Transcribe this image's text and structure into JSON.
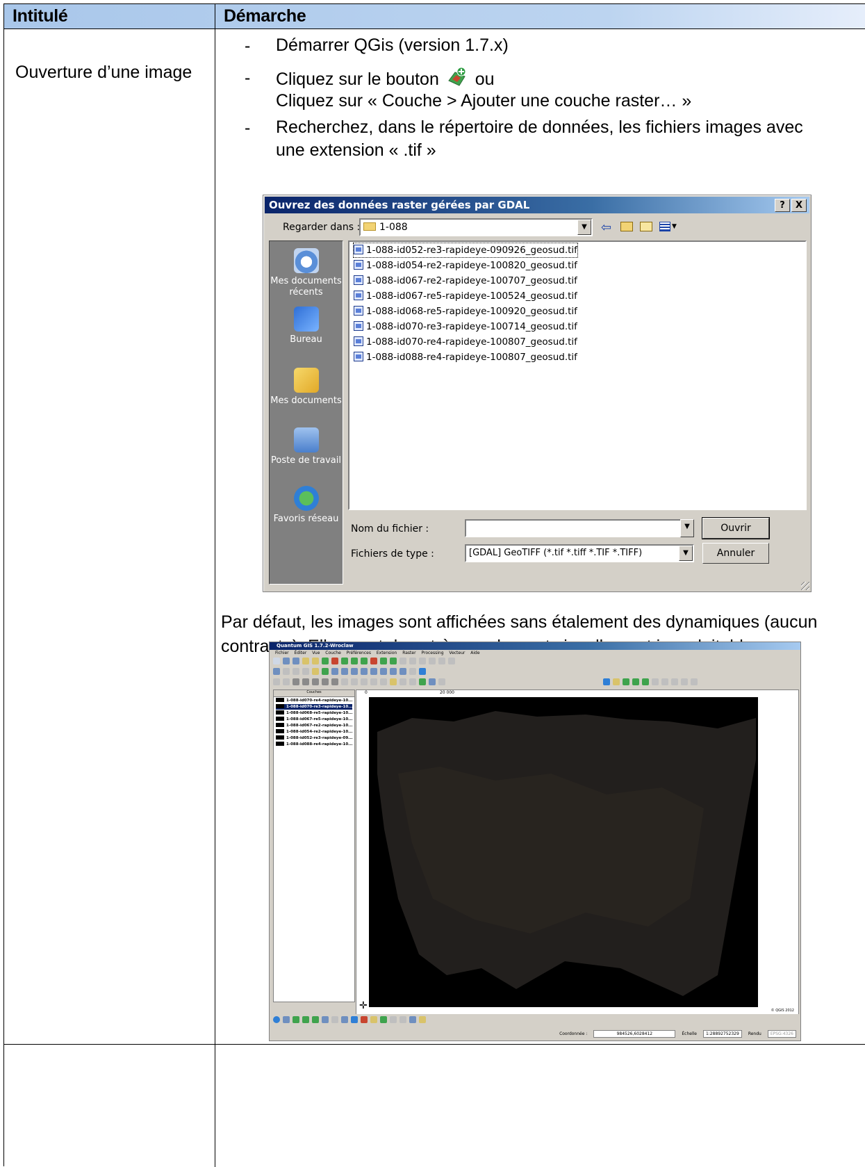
{
  "table": {
    "header_col1": "Intitulé",
    "header_col2": "Démarche",
    "row1_label": "Ouverture d’une image"
  },
  "steps": {
    "s1": "Démarrer QGis (version 1.7.x)",
    "s2a": "Cliquez sur le bouton",
    "s2b": "ou",
    "s2c": "Cliquez sur « Couche > Ajouter une couche raster… »",
    "s3a": "Recherchez, dans le répertoire de données, les fichiers images avec",
    "s3b": "une extension « .tif »",
    "dash": "-"
  },
  "dialog": {
    "title": "Ouvrez des données raster gérées par GDAL",
    "help_btn": "?",
    "close_btn": "X",
    "look_in_label": "Regarder dans :",
    "look_in_value": "1-088",
    "places": [
      "Mes documents récents",
      "Bureau",
      "Mes documents",
      "Poste de travail",
      "Favoris réseau"
    ],
    "files": [
      "1-088-id052-re3-rapideye-090926_geosud.tif",
      "1-088-id054-re2-rapideye-100820_geosud.tif",
      "1-088-id067-re2-rapideye-100707_geosud.tif",
      "1-088-id067-re5-rapideye-100524_geosud.tif",
      "1-088-id068-re5-rapideye-100920_geosud.tif",
      "1-088-id070-re3-rapideye-100714_geosud.tif",
      "1-088-id070-re4-rapideye-100807_geosud.tif",
      "1-088-id088-re4-rapideye-100807_geosud.tif"
    ],
    "filename_label": "Nom du fichier :",
    "filename_value": "",
    "filetype_label": "Fichiers de type :",
    "filetype_value": "[GDAL] GeoTIFF (*.tif *.tiff *.TIF *.TIFF)",
    "open_btn": "Ouvrir",
    "cancel_btn": "Annuler"
  },
  "paragraph": {
    "line1": "Par défaut, les images sont affichées sans étalement des dynamiques (aucun",
    "line2": "contraste). Elles sont donc très sombres et visuellement inexploitables."
  },
  "qgis": {
    "title": "Quantum GIS 1.7.2-Wroclaw",
    "menu": "Fichier Éditer Vue Couche Préférences Extension Raster Processing Vecteur Aide",
    "layers_header": "Couches",
    "layers": [
      "1-088-id070-re4-rapideye-10...",
      "1-088-id070-re3-rapideye-10...",
      "1-088-id068-re5-rapideye-10...",
      "1-088-id067-re5-rapideye-10...",
      "1-088-id067-re2-rapideye-10...",
      "1-088-id054-re2-rapideye-10...",
      "1-088-id052-re3-rapideye-09...",
      "1-088-id088-re4-rapideye-10..."
    ],
    "scale_start": "0",
    "scale_end": "20 000",
    "copyright": "© QGIS 2012",
    "coord_label": "Coordonnée :",
    "coord_value": "984526,6028412",
    "scale_label": "Échelle",
    "scale_value": "1:28892752329",
    "render_label": "Rendu",
    "epsg": "EPSG:4326"
  }
}
